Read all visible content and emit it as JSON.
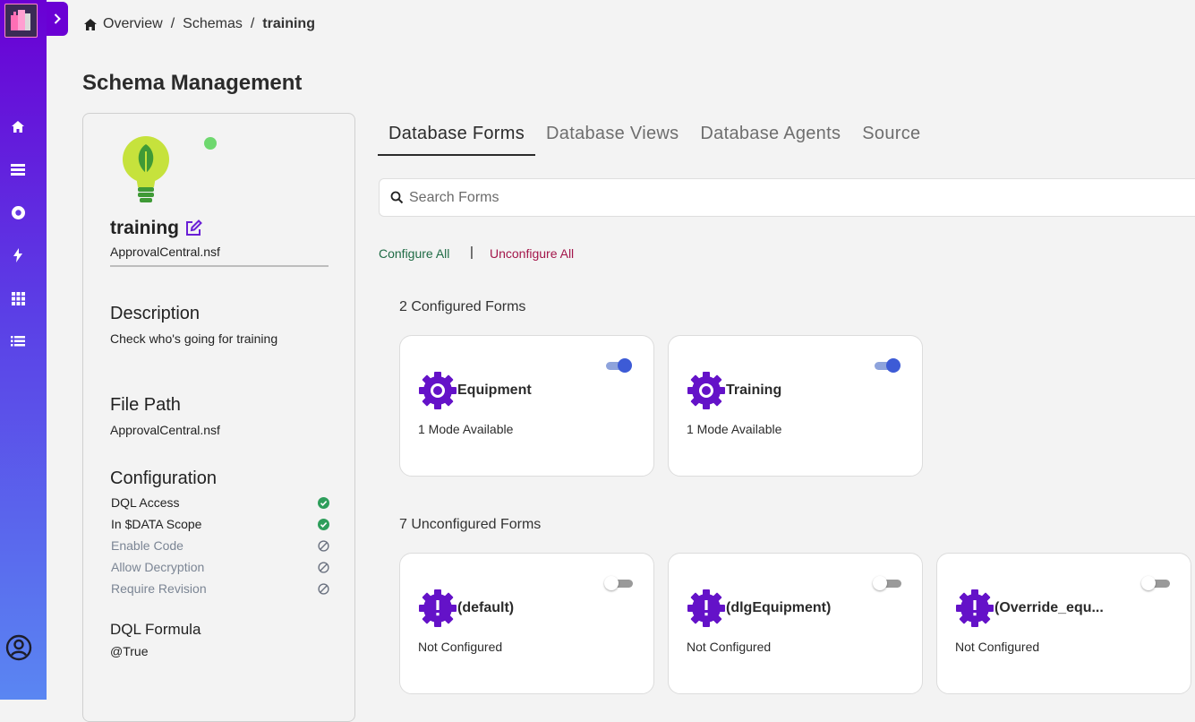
{
  "breadcrumb": {
    "items": [
      "Overview",
      "Schemas",
      "training"
    ],
    "separator": "/"
  },
  "page": {
    "title": "Schema Management"
  },
  "schema": {
    "name": "training",
    "file": "ApprovalCentral.nsf",
    "status_color": "#6fd86f",
    "description_title": "Description",
    "description": "Check who's going for training",
    "filepath_title": "File Path",
    "filepath": "ApprovalCentral.nsf",
    "configuration_title": "Configuration",
    "configuration": [
      {
        "label": "DQL Access",
        "enabled": true
      },
      {
        "label": "In $DATA Scope",
        "enabled": true
      },
      {
        "label": "Enable Code",
        "enabled": false
      },
      {
        "label": "Allow Decryption",
        "enabled": false
      },
      {
        "label": "Require Revision",
        "enabled": false
      }
    ],
    "formula_title": "DQL Formula",
    "formula": "@True"
  },
  "tabs": [
    "Database Forms",
    "Database Views",
    "Database Agents",
    "Source"
  ],
  "search": {
    "placeholder": "Search Forms"
  },
  "actions": {
    "configure_all": "Configure All",
    "separator": "|",
    "unconfigure_all": "Unconfigure All"
  },
  "configured": {
    "title": "2 Configured Forms",
    "forms": [
      {
        "name": "Equipment",
        "status": "1 Mode Available",
        "enabled": true
      },
      {
        "name": "Training",
        "status": "1 Mode Available",
        "enabled": true
      }
    ]
  },
  "unconfigured": {
    "title": "7 Unconfigured Forms",
    "forms": [
      {
        "name": "(default)",
        "status": "Not Configured",
        "enabled": false
      },
      {
        "name": "(dlgEquipment)",
        "status": "Not Configured",
        "enabled": false
      },
      {
        "name": "(Override_equ...",
        "status": "Not Configured",
        "enabled": false
      }
    ]
  },
  "colors": {
    "accent": "#6a00d4",
    "toggle_on": "#3d5bd6",
    "success": "#2e9e5b"
  }
}
